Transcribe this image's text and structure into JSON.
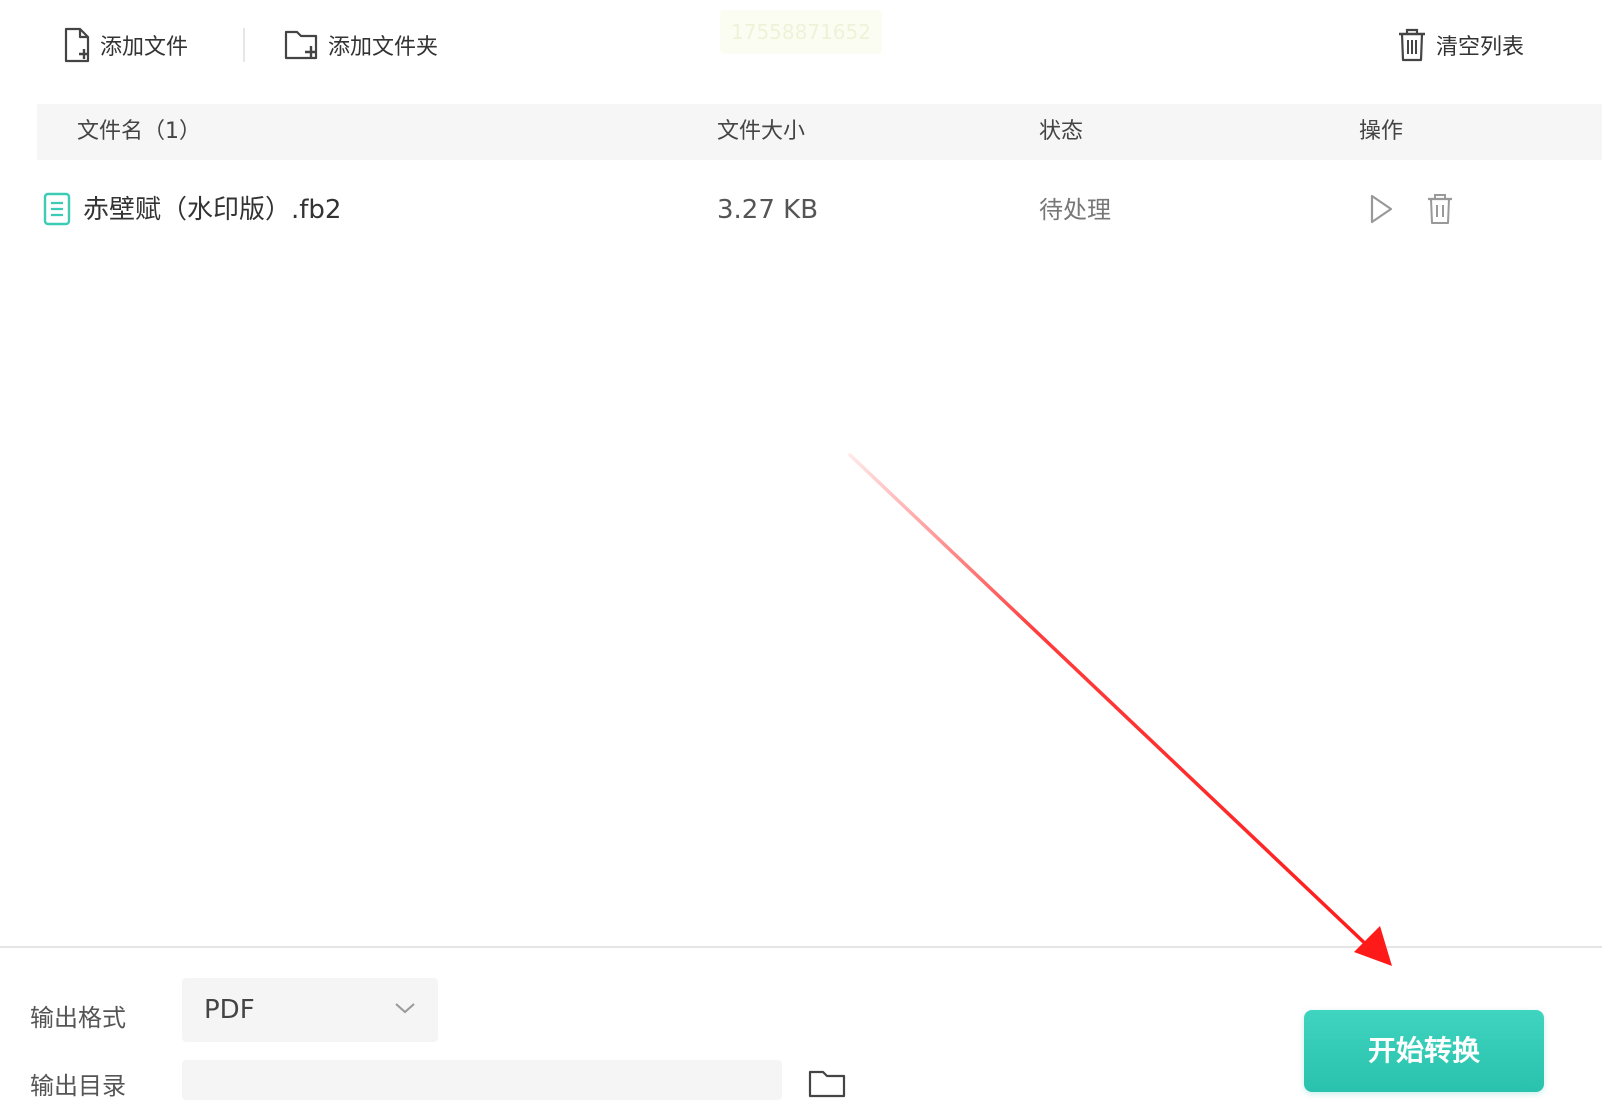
{
  "toolbar": {
    "add_file_label": "添加文件",
    "add_folder_label": "添加文件夹",
    "clear_list_label": "清空列表",
    "watermark_text": "17558871652"
  },
  "table": {
    "headers": {
      "name": "文件名（1）",
      "size": "文件大小",
      "status": "状态",
      "actions": "操作"
    },
    "rows": [
      {
        "name": "赤壁赋（水印版）.fb2",
        "size": "3.27 KB",
        "status": "待处理"
      }
    ]
  },
  "bottom": {
    "format_label": "输出格式",
    "format_value": "PDF",
    "path_label": "输出目录",
    "start_button": "开始转换"
  },
  "colors": {
    "accent": "#2cc6b0",
    "file_icon": "#3ccbb5",
    "arrow": "#ff1a1a"
  },
  "icons": [
    "add-file-icon",
    "add-folder-icon",
    "trash-icon",
    "file-doc-icon",
    "play-icon",
    "delete-icon",
    "chevron-down-icon",
    "folder-icon",
    "arrow-annotation"
  ]
}
